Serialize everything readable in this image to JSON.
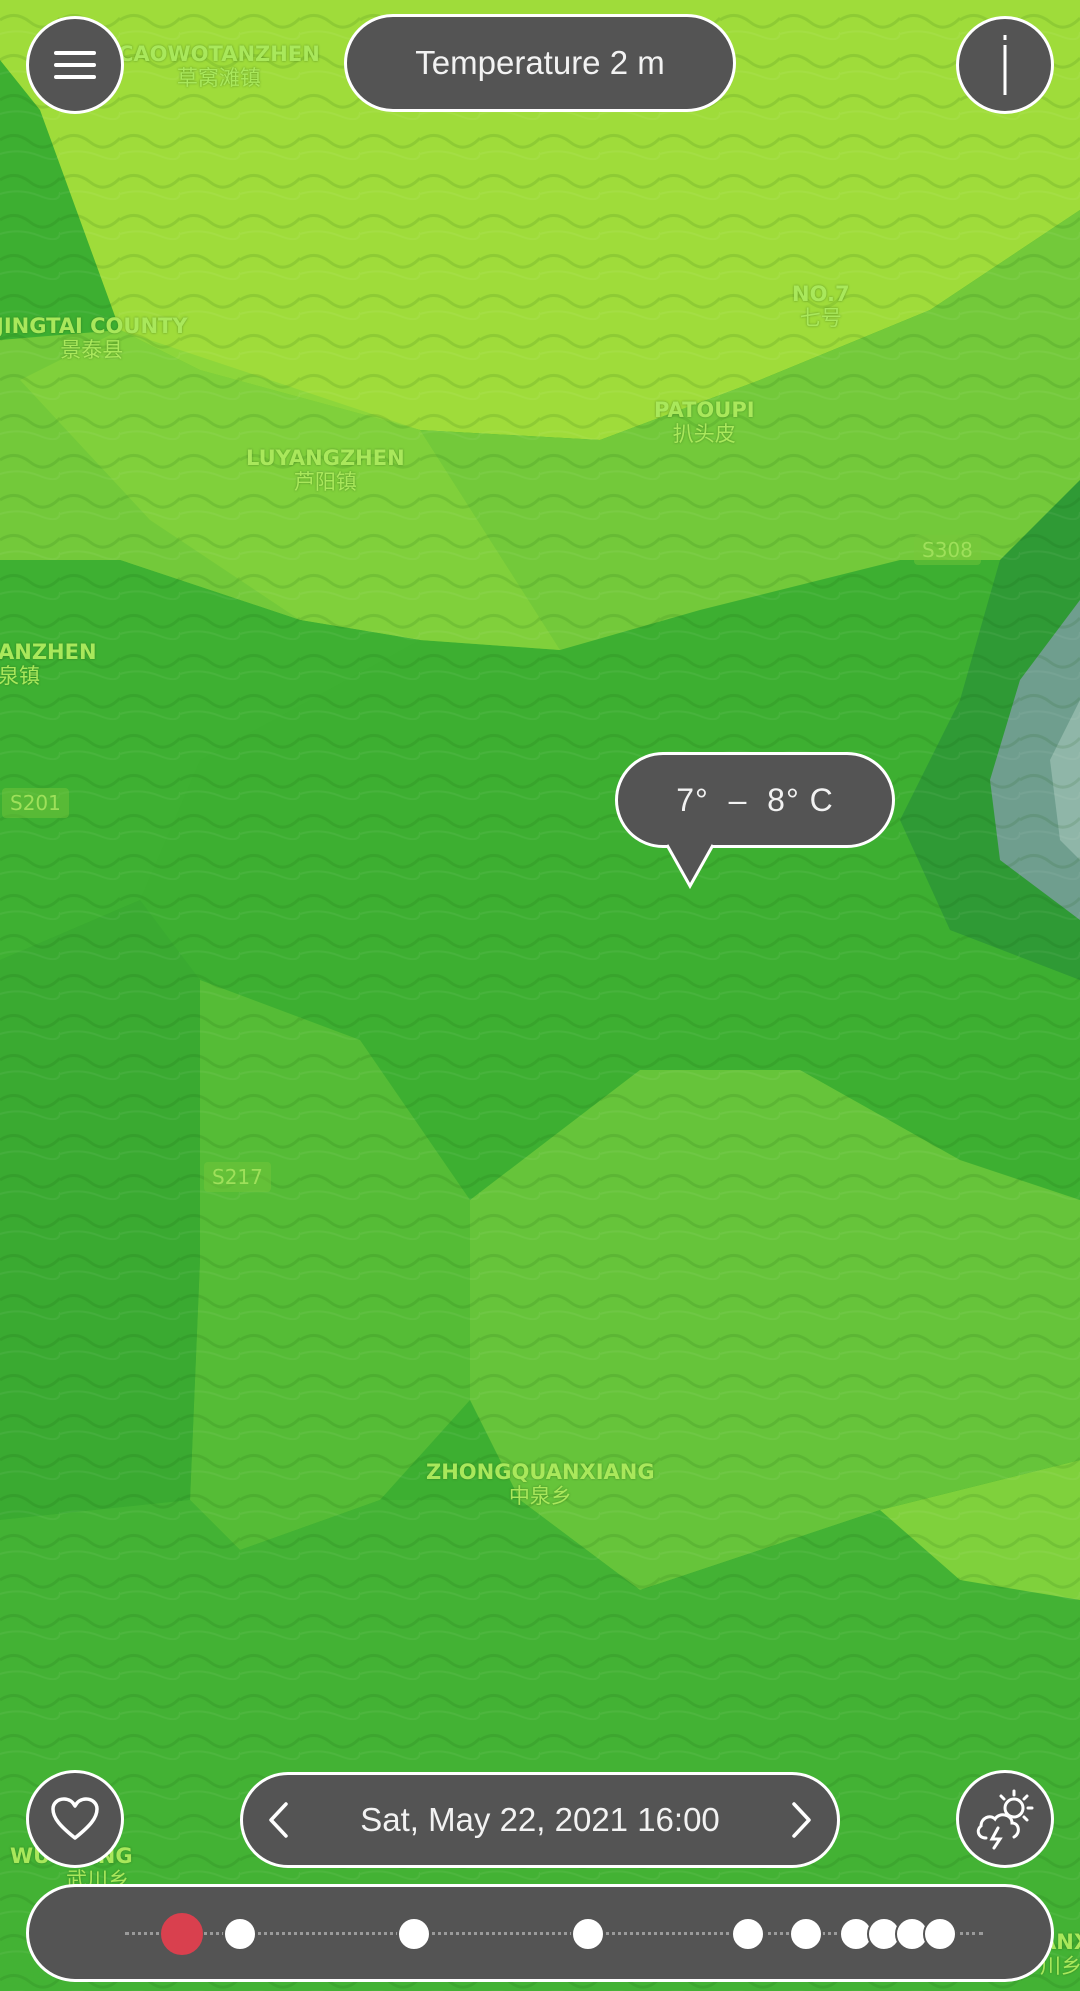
{
  "header": {
    "layer_title": "Temperature 2 m",
    "menu_icon": "hamburger-menu-icon",
    "info_icon": "info-icon"
  },
  "map": {
    "labels": [
      {
        "en": "CAOWOTANZHEN",
        "cn": "草窝滩镇"
      },
      {
        "en": "JINGTAI COUNTY",
        "cn": "景泰县"
      },
      {
        "en": "NO.7",
        "cn": "七号"
      },
      {
        "en": "PATOUPI",
        "cn": "扒头皮"
      },
      {
        "en": "LUYANGZHEN",
        "cn": "芦阳镇"
      },
      {
        "en": "ANZHEN",
        "cn": "泉镇"
      },
      {
        "en": "ZHONGQUANXIANG",
        "cn": "中泉乡"
      },
      {
        "en": "WU XIANG",
        "cn": "武川乡"
      },
      {
        "en": "ANX",
        "cn": "川乡"
      }
    ],
    "roads": [
      "S308",
      "S201",
      "S217"
    ],
    "colors": {
      "light_band": "#9fdc3a",
      "mid_band": "#5fc13a",
      "dark_band": "#34a82e",
      "cool_band": "#6f9e8e"
    }
  },
  "tooltip": {
    "value_text": "7°  –  8° C"
  },
  "bottom_bar": {
    "favorite_icon": "heart-icon",
    "weather_icon": "weather-cloud-sun-icon",
    "date_text": "Sat, May 22, 2021 16:00",
    "prev_icon": "chevron-left-icon",
    "next_icon": "chevron-right-icon"
  },
  "timeline": {
    "active_index": 0,
    "dots": 11,
    "accent_color": "#d9404e"
  }
}
